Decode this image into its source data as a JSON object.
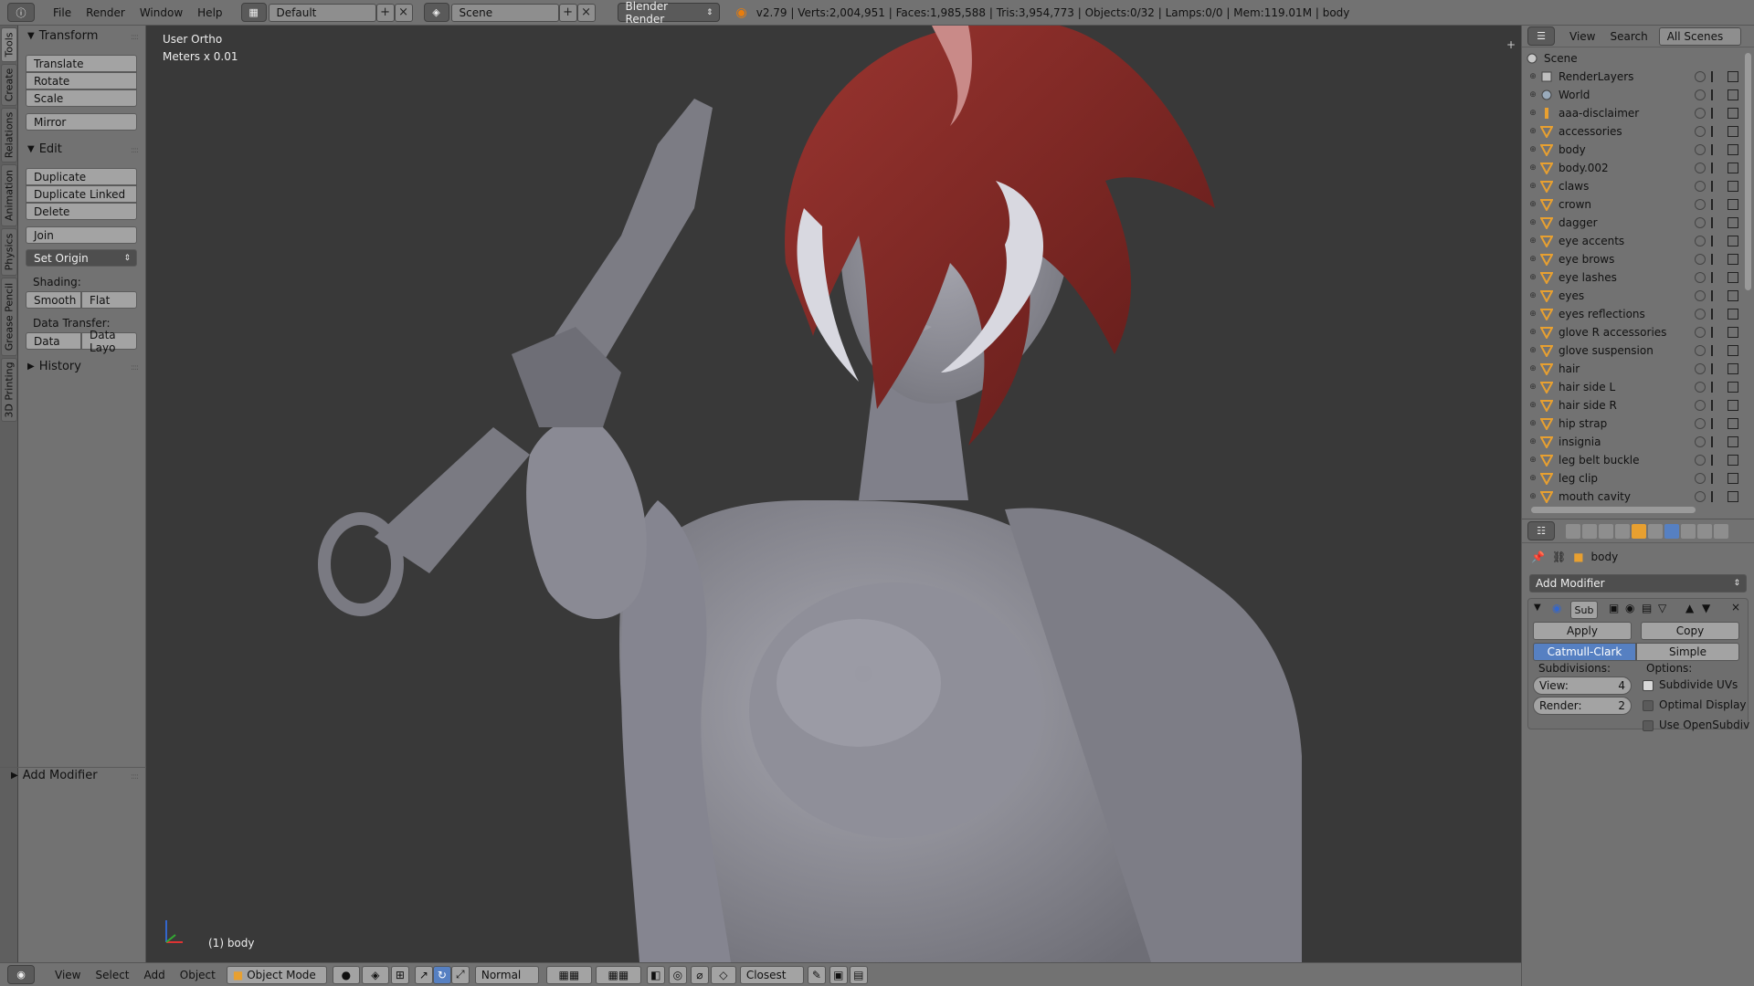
{
  "topbar": {
    "menus": [
      "File",
      "Render",
      "Window",
      "Help"
    ],
    "screen_layout": "Default",
    "scene": "Scene",
    "render_engine": "Blender Render",
    "stats": "v2.79 | Verts:2,004,951 | Faces:1,985,588 | Tris:3,954,773 | Objects:0/32 | Lamps:0/0 | Mem:119.01M | body"
  },
  "vtabs": [
    "Tools",
    "Create",
    "Relations",
    "Animation",
    "Physics",
    "Grease Pencil",
    "3D Printing"
  ],
  "shelf": {
    "transform_title": "Transform",
    "translate": "Translate",
    "rotate": "Rotate",
    "scale": "Scale",
    "mirror": "Mirror",
    "edit_title": "Edit",
    "duplicate": "Duplicate",
    "duplicate_linked": "Duplicate Linked",
    "delete": "Delete",
    "join": "Join",
    "set_origin": "Set Origin",
    "shading_label": "Shading:",
    "smooth": "Smooth",
    "flat": "Flat",
    "data_transfer_label": "Data Transfer:",
    "data": "Data",
    "data_layout": "Data Layo",
    "history_title": "History",
    "add_modifier_title": "Add Modifier"
  },
  "viewport": {
    "view_name": "User Ortho",
    "scale": "Meters x 0.01",
    "active_object": "(1) body"
  },
  "bottombar": {
    "menus": [
      "View",
      "Select",
      "Add",
      "Object"
    ],
    "mode": "Object Mode",
    "pivot_orientation": "Normal",
    "snap_target": "Closest"
  },
  "outliner": {
    "menus": [
      "View",
      "Search"
    ],
    "filter": "All Scenes",
    "scene_root": "Scene",
    "items": [
      {
        "name": "RenderLayers",
        "kind": "renderlayers"
      },
      {
        "name": "World",
        "kind": "world"
      },
      {
        "name": "aaa-disclaimer",
        "kind": "text"
      },
      {
        "name": "accessories",
        "kind": "mesh"
      },
      {
        "name": "body",
        "kind": "mesh"
      },
      {
        "name": "body.002",
        "kind": "mesh"
      },
      {
        "name": "claws",
        "kind": "mesh"
      },
      {
        "name": "crown",
        "kind": "mesh"
      },
      {
        "name": "dagger",
        "kind": "mesh"
      },
      {
        "name": "eye accents",
        "kind": "mesh"
      },
      {
        "name": "eye brows",
        "kind": "mesh"
      },
      {
        "name": "eye lashes",
        "kind": "mesh"
      },
      {
        "name": "eyes",
        "kind": "mesh"
      },
      {
        "name": "eyes reflections",
        "kind": "mesh"
      },
      {
        "name": "glove R accessories",
        "kind": "mesh"
      },
      {
        "name": "glove suspension",
        "kind": "mesh"
      },
      {
        "name": "hair",
        "kind": "mesh"
      },
      {
        "name": "hair side L",
        "kind": "mesh"
      },
      {
        "name": "hair side R",
        "kind": "mesh"
      },
      {
        "name": "hip strap",
        "kind": "mesh"
      },
      {
        "name": "insignia",
        "kind": "mesh"
      },
      {
        "name": "leg belt buckle",
        "kind": "mesh"
      },
      {
        "name": "leg clip",
        "kind": "mesh"
      },
      {
        "name": "mouth cavity",
        "kind": "mesh"
      }
    ]
  },
  "properties": {
    "context_object": "body",
    "add_modifier": "Add Modifier",
    "modifier_name": "Sub",
    "apply": "Apply",
    "copy": "Copy",
    "catmull_clark": "Catmull-Clark",
    "simple": "Simple",
    "subdivisions_label": "Subdivisions:",
    "options_label": "Options:",
    "view_label": "View:",
    "view_value": "4",
    "render_label": "Render:",
    "render_value": "2",
    "subdivide_uvs": "Subdivide UVs",
    "optimal_display": "Optimal Display",
    "use_opensubdiv": "Use OpenSubdiv",
    "subdivide_uvs_checked": true,
    "optimal_display_checked": false,
    "use_opensubdiv_checked": false
  },
  "colors": {
    "panel": "#727272",
    "viewport": "#393939",
    "accent": "#5680c2",
    "mesh_icon": "#e8a030",
    "hair_red": "#8b2b26",
    "skin": "#8e8e96"
  }
}
